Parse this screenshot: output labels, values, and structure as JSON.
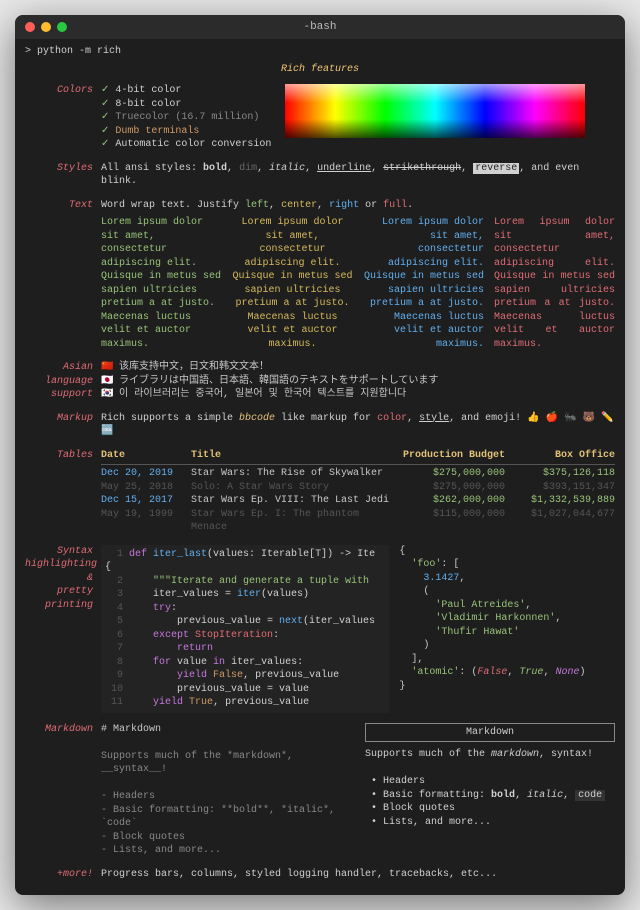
{
  "window": {
    "title": "-bash"
  },
  "prompt": {
    "symbol": ">",
    "cmd": "python -m rich"
  },
  "heading": "Rich features",
  "sections": {
    "colors": {
      "label": "Colors",
      "items": [
        "4-bit color",
        "8-bit color",
        "Truecolor (16.7 million)",
        "Dumb terminals",
        "Automatic color conversion"
      ]
    },
    "styles": {
      "label": "Styles",
      "prefix": "All ansi styles: ",
      "bold": "bold",
      "dim": "dim",
      "italic": "italic",
      "underline": "underline",
      "strike": "strikethrough",
      "reverse": "reverse",
      "suffix": ", and even blink."
    },
    "text": {
      "label": "Text",
      "line": {
        "p1": "Word wrap text. Justify ",
        "left": "left",
        "p2": ", ",
        "center": "center",
        "p3": ", ",
        "right": "right",
        "p4": " or ",
        "full": "full",
        "p5": "."
      },
      "lorem": "Lorem ipsum dolor sit amet, consectetur adipiscing elit. Quisque in metus sed sapien ultricies pretium a at justo. Maecenas luctus velit et auctor maximus."
    },
    "asian": {
      "label_l1": "Asian",
      "label_l2": "language",
      "label_l3": "support",
      "flags": [
        "🇨🇳",
        "🇯🇵",
        "🇰🇷"
      ],
      "lines": [
        "该库支持中文，日文和韩文文本！",
        "ライブラリは中国語、日本語、韓国語のテキストをサポートしています",
        "이 라이브러리는 중국어, 일본어 및 한국어 텍스트를 지원합니다"
      ]
    },
    "markup": {
      "label": "Markup",
      "p1": "Rich supports a simple ",
      "bbcode": "bbcode",
      "p2": " like markup for ",
      "color": "color",
      "p3": ", ",
      "style": "style",
      "p4": ", and emoji! 👍 🍎 🐜 🐻 ✏️ 🆒"
    },
    "tables": {
      "label": "Tables",
      "headers": [
        "Date",
        "Title",
        "Production Budget",
        "Box Office"
      ],
      "rows": [
        {
          "date": "Dec 20, 2019",
          "title": "Star Wars: The Rise of Skywalker",
          "budget": "$275,000,000",
          "box": "$375,126,118"
        },
        {
          "date": "May 25, 2018",
          "title": "Solo: A Star Wars Story",
          "budget": "$275,000,000",
          "box": "$393,151,347"
        },
        {
          "date": "Dec 15, 2017",
          "title": "Star Wars Ep. VIII: The Last Jedi",
          "budget": "$262,000,000",
          "box": "$1,332,539,889"
        },
        {
          "date": "May 19, 1999",
          "title": "Star Wars Ep. I: The phantom Menace",
          "budget": "$115,000,000",
          "box": "$1,027,044,677"
        }
      ]
    },
    "syntax": {
      "label_l1": "Syntax",
      "label_l2": "highlighting",
      "label_l3": "&",
      "label_l4": "pretty",
      "label_l5": "printing",
      "code_lines": [
        "def iter_last(values: Iterable[T]) -> Ite",
        "    \"\"\"Iterate and generate a tuple with",
        "    iter_values = iter(values)",
        "    try:",
        "        previous_value = next(iter_values",
        "    except StopIteration:",
        "        return",
        "    for value in iter_values:",
        "        yield False, previous_value",
        "        previous_value = value",
        "    yield True, previous_value"
      ],
      "data": {
        "foo_key": "'foo'",
        "pi": "3.1427",
        "names": [
          "'Paul Atreides'",
          "'Vladimir Harkonnen'",
          "'Thufir Hawat'"
        ],
        "atomic_key": "'atomic'",
        "atomic_vals": [
          "False",
          "True",
          "None"
        ]
      }
    },
    "markdown": {
      "label": "Markdown",
      "src_title": "# Markdown",
      "src_lead": "Supports much of the *markdown*, __syntax__!",
      "src_items": [
        "- Headers",
        "- Basic formatting: **bold**, *italic*, `code`",
        "- Block quotes",
        "- Lists, and more..."
      ],
      "rend_title": "Markdown",
      "rend_lead_p1": "Supports much of the ",
      "rend_lead_md": "markdown",
      "rend_lead_p2": ", syntax!",
      "rend_items_l1": "Headers",
      "rend_items_l2a": "Basic formatting: ",
      "rend_items_l2b": "bold",
      "rend_items_l2c": ", ",
      "rend_items_l2d": "italic",
      "rend_items_l2e": ", ",
      "rend_items_l2f": "code",
      "rend_items_l3": "Block quotes",
      "rend_items_l4": "Lists, and more..."
    },
    "more": {
      "label": "+more!",
      "text": "Progress bars, columns, styled logging handler, tracebacks, etc..."
    }
  }
}
